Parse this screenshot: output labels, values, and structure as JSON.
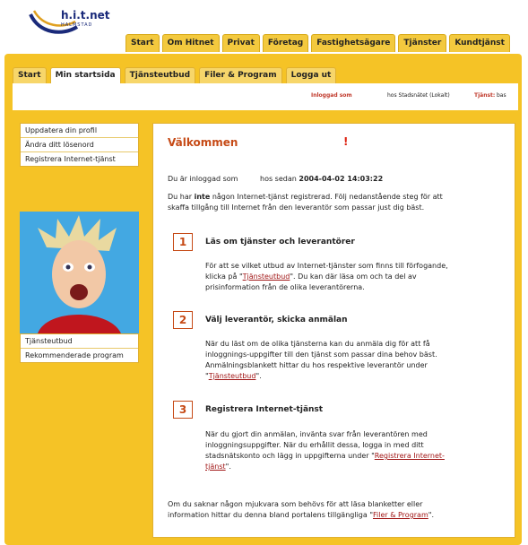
{
  "header": {
    "brand": "h.i.t.net",
    "brand_sub": "HALMSTAD",
    "tabs": [
      "Start",
      "Om Hitnet",
      "Privat",
      "Företag",
      "Fastighetsägare",
      "Tjänster",
      "Kundtjänst"
    ]
  },
  "subnav": {
    "tabs": [
      "Start",
      "Min startsida",
      "Tjänsteutbud",
      "Filer & Program",
      "Logga ut"
    ],
    "active": "Min startsida"
  },
  "infobar": {
    "logged_in": "Inloggad som",
    "at": "hos Stadsnätet (Lokalt)",
    "service": "Tjänst:",
    "service_value": "bas"
  },
  "sidebar": {
    "top_items": [
      "Uppdatera din profil",
      "Ändra ditt lösenord",
      "Registrera Internet-tjänst"
    ],
    "bottom_items": [
      "Tjänsteutbud",
      "Rekommenderade program"
    ]
  },
  "main": {
    "title": "Välkommen",
    "exclaim": "!",
    "login_line_a": "Du är inloggad som",
    "login_line_b": "hos sedan",
    "login_date": "2004-04-02 14:03:22",
    "intro_a": "Du har",
    "intro_b": "inte",
    "intro_c": "någon Internet-tjänst registrerad. Följ nedanstående steg för att",
    "intro_d": "skaffa tillgång till Internet från den leverantör som passar just dig bäst.",
    "steps": [
      {
        "num": "1",
        "heading": "Läs om tjänster och leverantörer",
        "l1": "För att se vilket utbud av Internet-tjänster som finns till förfogande,",
        "l2a": "klicka på \"",
        "link": "Tjänsteutbud",
        "l2b": "\". Du kan där läsa om och ta del av",
        "l3": "prisinformation från de olika leverantörerna."
      },
      {
        "num": "2",
        "heading": "Välj leverantör, skicka anmälan",
        "l1": "När du läst om de olika tjänsterna kan du anmäla dig för att få",
        "l2": "inloggnings-uppgifter till den tjänst som passar dina behov bäst.",
        "l3": "Anmälningsblankett hittar du hos respektive leverantör under",
        "l4a": "\"",
        "link": "Tjänsteutbud",
        "l4b": "\"."
      },
      {
        "num": "3",
        "heading": "Registrera Internet-tjänst",
        "l1": "När du gjort din anmälan, invänta svar från leverantören med",
        "l2": "inloggningsuppgifter. När du erhållit dessa, logga in med ditt",
        "l3a": "stadsnätskonto och lägg in uppgifterna under \"",
        "link": "Registrera Internet-",
        "link2": "tjänst",
        "l4b": "\"."
      }
    ],
    "footer_a": "Om du saknar någon mjukvara som behövs för att läsa blanketter eller",
    "footer_b": "information hittar du denna bland portalens tillgängliga \"",
    "footer_link": "Filer & Program",
    "footer_c": "\"."
  }
}
